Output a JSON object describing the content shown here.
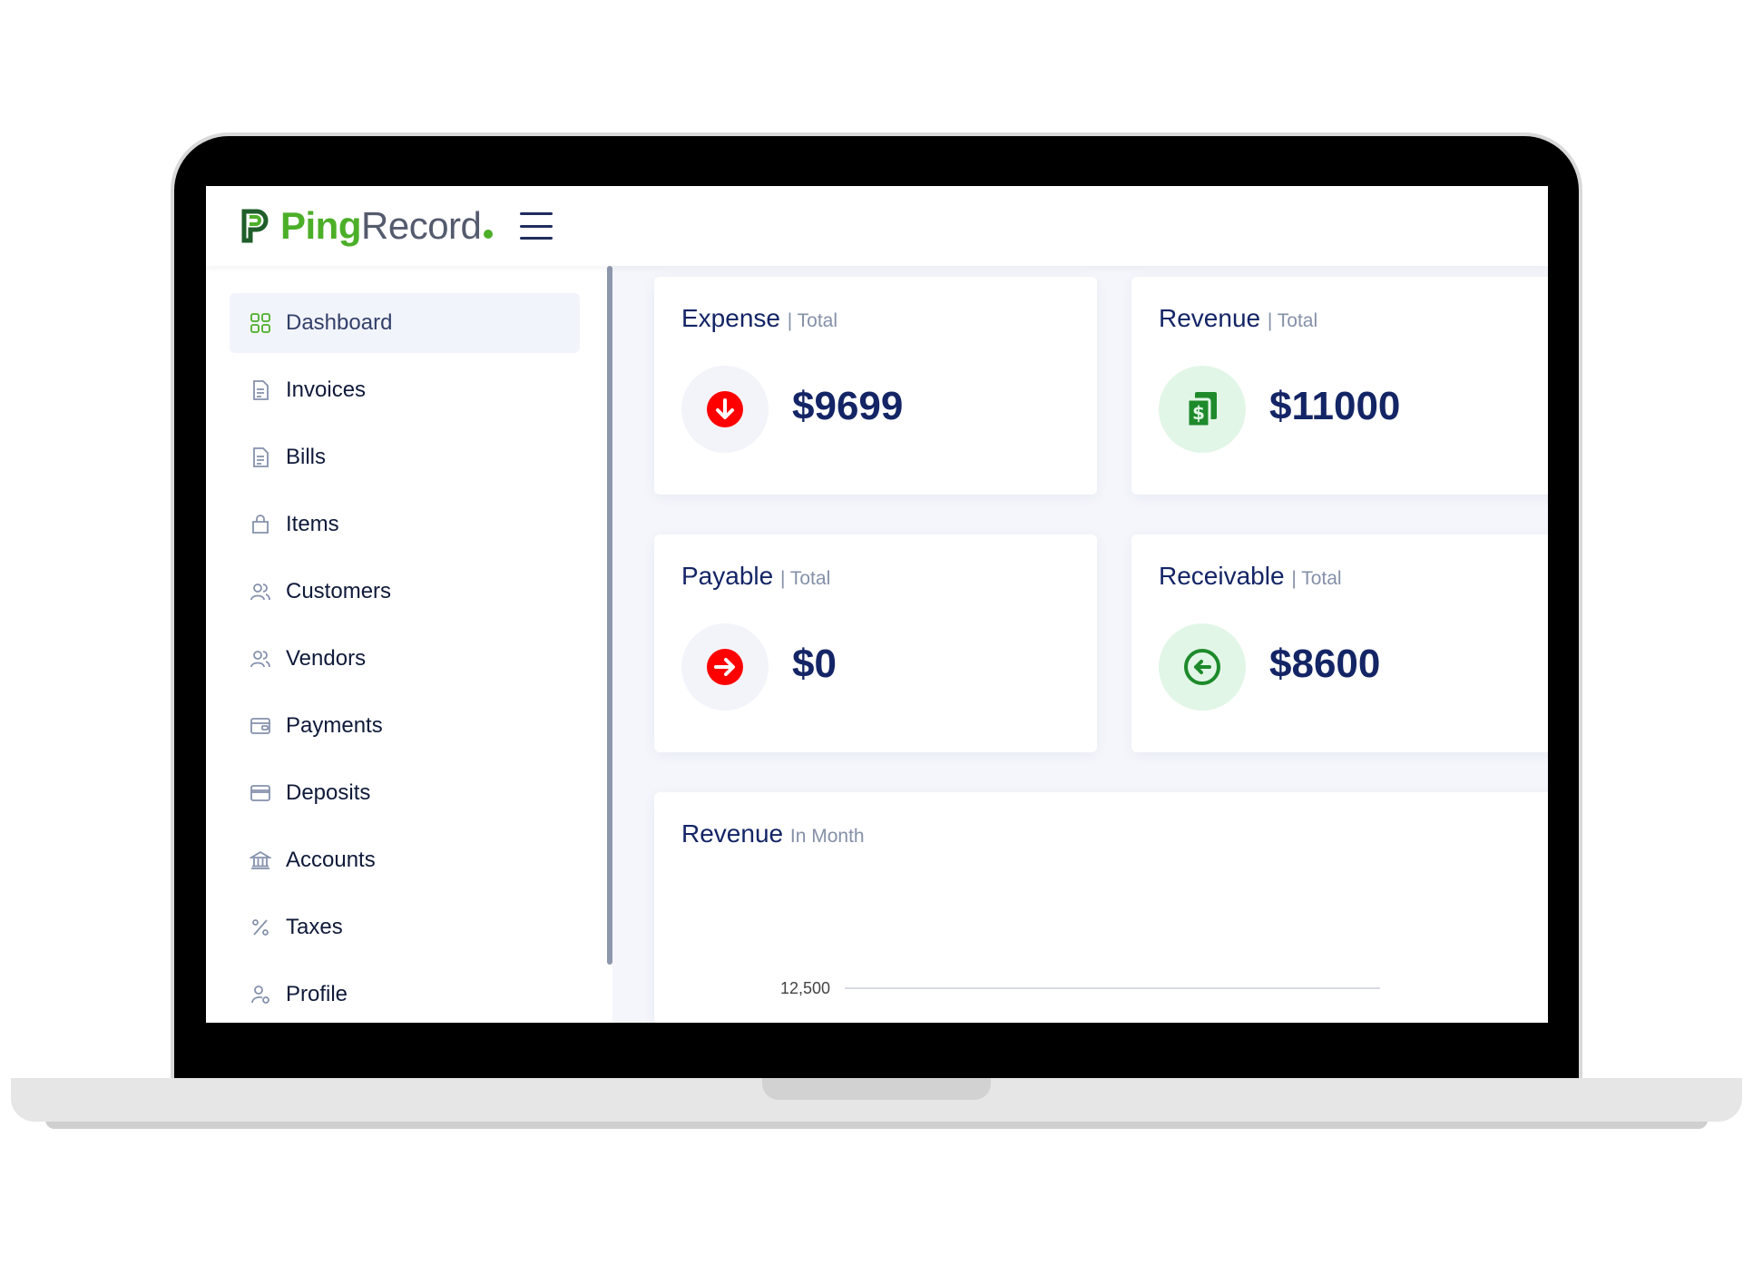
{
  "app": {
    "logo_ping": "Ping",
    "logo_record": "Record"
  },
  "colors": {
    "brand_green": "#4caf28",
    "navy": "#142566",
    "red": "#ff0000",
    "green": "#1e8a2b"
  },
  "sidebar": {
    "items": [
      {
        "label": "Dashboard",
        "icon": "grid-icon",
        "active": true
      },
      {
        "label": "Invoices",
        "icon": "document-icon"
      },
      {
        "label": "Bills",
        "icon": "document-icon"
      },
      {
        "label": "Items",
        "icon": "bag-icon"
      },
      {
        "label": "Customers",
        "icon": "users-icon"
      },
      {
        "label": "Vendors",
        "icon": "users-icon"
      },
      {
        "label": "Payments",
        "icon": "wallet-icon"
      },
      {
        "label": "Deposits",
        "icon": "card-icon"
      },
      {
        "label": "Accounts",
        "icon": "bank-icon"
      },
      {
        "label": "Taxes",
        "icon": "percent-icon"
      },
      {
        "label": "Profile",
        "icon": "user-gear-icon"
      }
    ]
  },
  "cards": {
    "expense": {
      "title": "Expense",
      "sub": "| Total",
      "value": "$9699",
      "icon": "arrow-down-circle-icon"
    },
    "revenue": {
      "title": "Revenue",
      "sub": "| Total",
      "value": "$11000",
      "icon": "money-copy-icon"
    },
    "payable": {
      "title": "Payable",
      "sub": "| Total",
      "value": "$0",
      "icon": "arrow-right-circle-icon"
    },
    "receivable": {
      "title": "Receivable",
      "sub": "| Total",
      "value": "$8600",
      "icon": "arrow-left-circle-icon"
    }
  },
  "revenue_chart": {
    "title": "Revenue",
    "sub": "In Month"
  },
  "chart_data": {
    "type": "line",
    "title": "Revenue In Month",
    "y_ticks_visible": [
      "12,500"
    ],
    "series": []
  }
}
